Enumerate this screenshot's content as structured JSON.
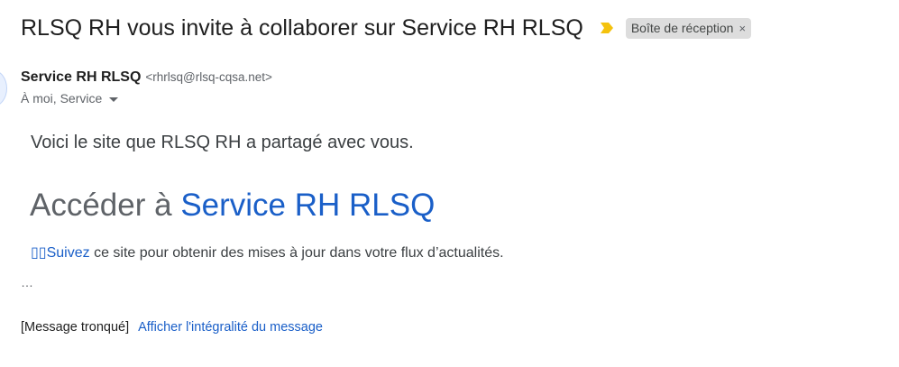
{
  "email": {
    "subject": "RLSQ RH vous invite à collaborer sur Service RH RLSQ",
    "importance_icon": "importance-marker-icon",
    "label": "Boîte de réception",
    "label_remove": "×",
    "sender_name": "Service RH RLSQ",
    "sender_email": "<rhrlsq@rlsq-cqsa.net>",
    "recipients": "À moi, Service"
  },
  "body": {
    "intro": "Voici le site que RLSQ RH a partagé avec vous.",
    "access_prefix": "Accéder à ",
    "site_name": "Service RH RLSQ",
    "follow_link": "▯▯Suivez",
    "follow_text": " ce site pour obtenir des mises à jour dans votre flux d’actualités.",
    "ellipsis": "…"
  },
  "footer": {
    "truncated_label": "[Message tronqué]",
    "view_full_link": "Afficher l'intégralité du message"
  },
  "colors": {
    "link": "#1a5fc8",
    "importance": "#f4c20d",
    "label_bg": "#dddddd"
  }
}
